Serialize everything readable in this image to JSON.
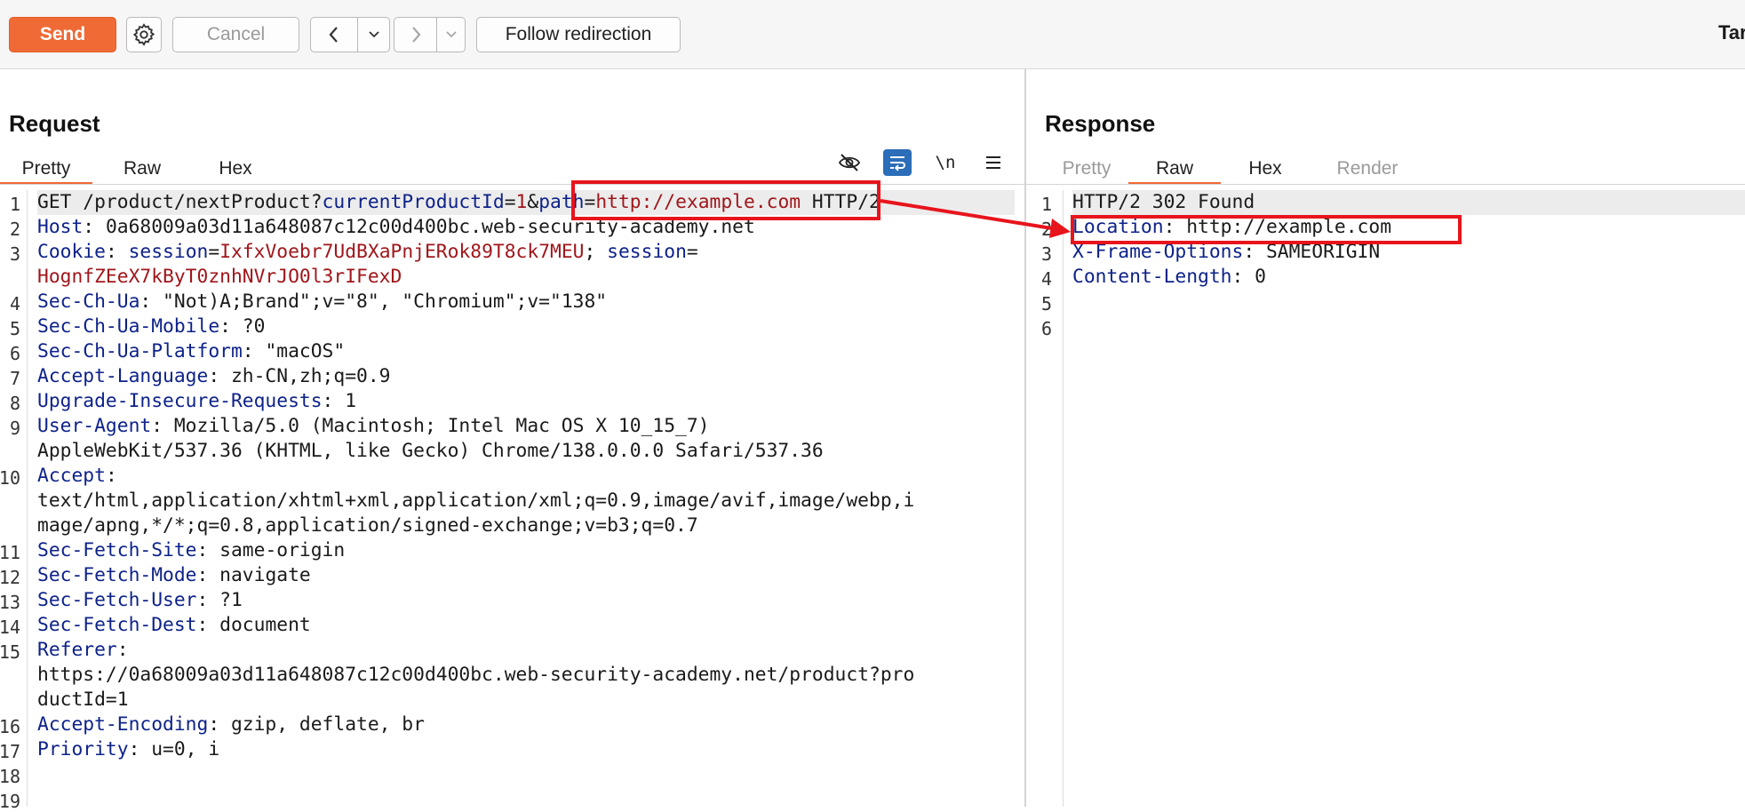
{
  "toolbar": {
    "send_label": "Send",
    "cancel_label": "Cancel",
    "follow_label": "Follow redirection",
    "target_label": "Tar",
    "icons": {
      "settings": "gear-icon",
      "back": "chevron-left-icon",
      "forward": "chevron-right-icon",
      "history": "chevron-down-icon"
    }
  },
  "request": {
    "title": "Request",
    "tabs": [
      {
        "label": "Pretty",
        "active": true
      },
      {
        "label": "Raw",
        "active": false
      },
      {
        "label": "Hex",
        "active": false
      }
    ],
    "tools": {
      "hide_icon": "eye-slash-icon",
      "wrap_icon": "wrap-lines-icon",
      "newline_label": "\\n",
      "menu_icon": "hamburger-menu-icon"
    },
    "line_numbers": [
      "1",
      "2",
      "3",
      "",
      "4",
      "5",
      "6",
      "7",
      "8",
      "9",
      "",
      "10",
      "",
      "",
      "11",
      "12",
      "13",
      "14",
      "15",
      "",
      "",
      "16",
      "17",
      "18",
      "19"
    ],
    "lines": [
      [
        {
          "t": "GET /product/nextProduct?",
          "c": "v"
        },
        {
          "t": "currentProductId",
          "c": "k"
        },
        {
          "t": "=",
          "c": "v"
        },
        {
          "t": "1",
          "c": "r"
        },
        {
          "t": "&",
          "c": "v"
        },
        {
          "t": "path",
          "c": "k"
        },
        {
          "t": "=",
          "c": "v"
        },
        {
          "t": "http://example.com",
          "c": "r"
        },
        {
          "t": " HTTP/2",
          "c": "v"
        }
      ],
      [
        {
          "t": "Host",
          "c": "k"
        },
        {
          "t": ": 0a68009a03d11a648087c12c00d400bc.web-security-academy.net",
          "c": "v"
        }
      ],
      [
        {
          "t": "Cookie",
          "c": "k"
        },
        {
          "t": ": ",
          "c": "v"
        },
        {
          "t": "session",
          "c": "k"
        },
        {
          "t": "=",
          "c": "v"
        },
        {
          "t": "IxfxVoebr7UdBXaPnjERok89T8ck7MEU",
          "c": "r"
        },
        {
          "t": "; ",
          "c": "v"
        },
        {
          "t": "session",
          "c": "k"
        },
        {
          "t": "=",
          "c": "v"
        }
      ],
      [
        {
          "t": "HognfZEeX7kByT0znhNVrJO0l3rIFexD",
          "c": "r"
        }
      ],
      [
        {
          "t": "Sec-Ch-Ua",
          "c": "k"
        },
        {
          "t": ": \"Not)A;Brand\";v=\"8\", \"Chromium\";v=\"138\"",
          "c": "v"
        }
      ],
      [
        {
          "t": "Sec-Ch-Ua-Mobile",
          "c": "k"
        },
        {
          "t": ": ?0",
          "c": "v"
        }
      ],
      [
        {
          "t": "Sec-Ch-Ua-Platform",
          "c": "k"
        },
        {
          "t": ": \"macOS\"",
          "c": "v"
        }
      ],
      [
        {
          "t": "Accept-Language",
          "c": "k"
        },
        {
          "t": ": zh-CN,zh;q=0.9",
          "c": "v"
        }
      ],
      [
        {
          "t": "Upgrade-Insecure-Requests",
          "c": "k"
        },
        {
          "t": ": 1",
          "c": "v"
        }
      ],
      [
        {
          "t": "User-Agent",
          "c": "k"
        },
        {
          "t": ": Mozilla/5.0 (Macintosh; Intel Mac OS X 10_15_7)",
          "c": "v"
        }
      ],
      [
        {
          "t": "AppleWebKit/537.36 (KHTML, like Gecko) Chrome/138.0.0.0 Safari/537.36",
          "c": "v"
        }
      ],
      [
        {
          "t": "Accept",
          "c": "k"
        },
        {
          "t": ":",
          "c": "v"
        }
      ],
      [
        {
          "t": "text/html,application/xhtml+xml,application/xml;q=0.9,image/avif,image/webp,i",
          "c": "v"
        }
      ],
      [
        {
          "t": "mage/apng,*/*;q=0.8,application/signed-exchange;v=b3;q=0.7",
          "c": "v"
        }
      ],
      [
        {
          "t": "Sec-Fetch-Site",
          "c": "k"
        },
        {
          "t": ": same-origin",
          "c": "v"
        }
      ],
      [
        {
          "t": "Sec-Fetch-Mode",
          "c": "k"
        },
        {
          "t": ": navigate",
          "c": "v"
        }
      ],
      [
        {
          "t": "Sec-Fetch-User",
          "c": "k"
        },
        {
          "t": ": ?1",
          "c": "v"
        }
      ],
      [
        {
          "t": "Sec-Fetch-Dest",
          "c": "k"
        },
        {
          "t": ": document",
          "c": "v"
        }
      ],
      [
        {
          "t": "Referer",
          "c": "k"
        },
        {
          "t": ":",
          "c": "v"
        }
      ],
      [
        {
          "t": "https://0a68009a03d11a648087c12c00d400bc.web-security-academy.net/product?pro",
          "c": "v"
        }
      ],
      [
        {
          "t": "ductId=1",
          "c": "v"
        }
      ],
      [
        {
          "t": "Accept-Encoding",
          "c": "k"
        },
        {
          "t": ": gzip, deflate, br",
          "c": "v"
        }
      ],
      [
        {
          "t": "Priority",
          "c": "k"
        },
        {
          "t": ": u=0, i",
          "c": "v"
        }
      ],
      [],
      []
    ]
  },
  "response": {
    "title": "Response",
    "tabs": [
      {
        "label": "Pretty",
        "active": false,
        "dim": true
      },
      {
        "label": "Raw",
        "active": true,
        "dim": false
      },
      {
        "label": "Hex",
        "active": false,
        "dim": false
      },
      {
        "label": "Render",
        "active": false,
        "dim": true
      }
    ],
    "line_numbers": [
      "1",
      "2",
      "3",
      "4",
      "5",
      "6"
    ],
    "lines": [
      [
        {
          "t": "HTTP/2 302 Found",
          "c": "v"
        }
      ],
      [
        {
          "t": "Location",
          "c": "k"
        },
        {
          "t": ": http://example.com",
          "c": "v"
        }
      ],
      [
        {
          "t": "X-Frame-Options",
          "c": "k"
        },
        {
          "t": ": SAMEORIGIN",
          "c": "v"
        }
      ],
      [
        {
          "t": "Content-Length",
          "c": "k"
        },
        {
          "t": ": 0",
          "c": "v"
        }
      ],
      [],
      []
    ]
  },
  "colors": {
    "accent": "#ef6a35",
    "annotation": "#e8141c",
    "header_key": "#0e228a",
    "param_value": "#a0161b",
    "wrap_active": "#2b6db8"
  }
}
